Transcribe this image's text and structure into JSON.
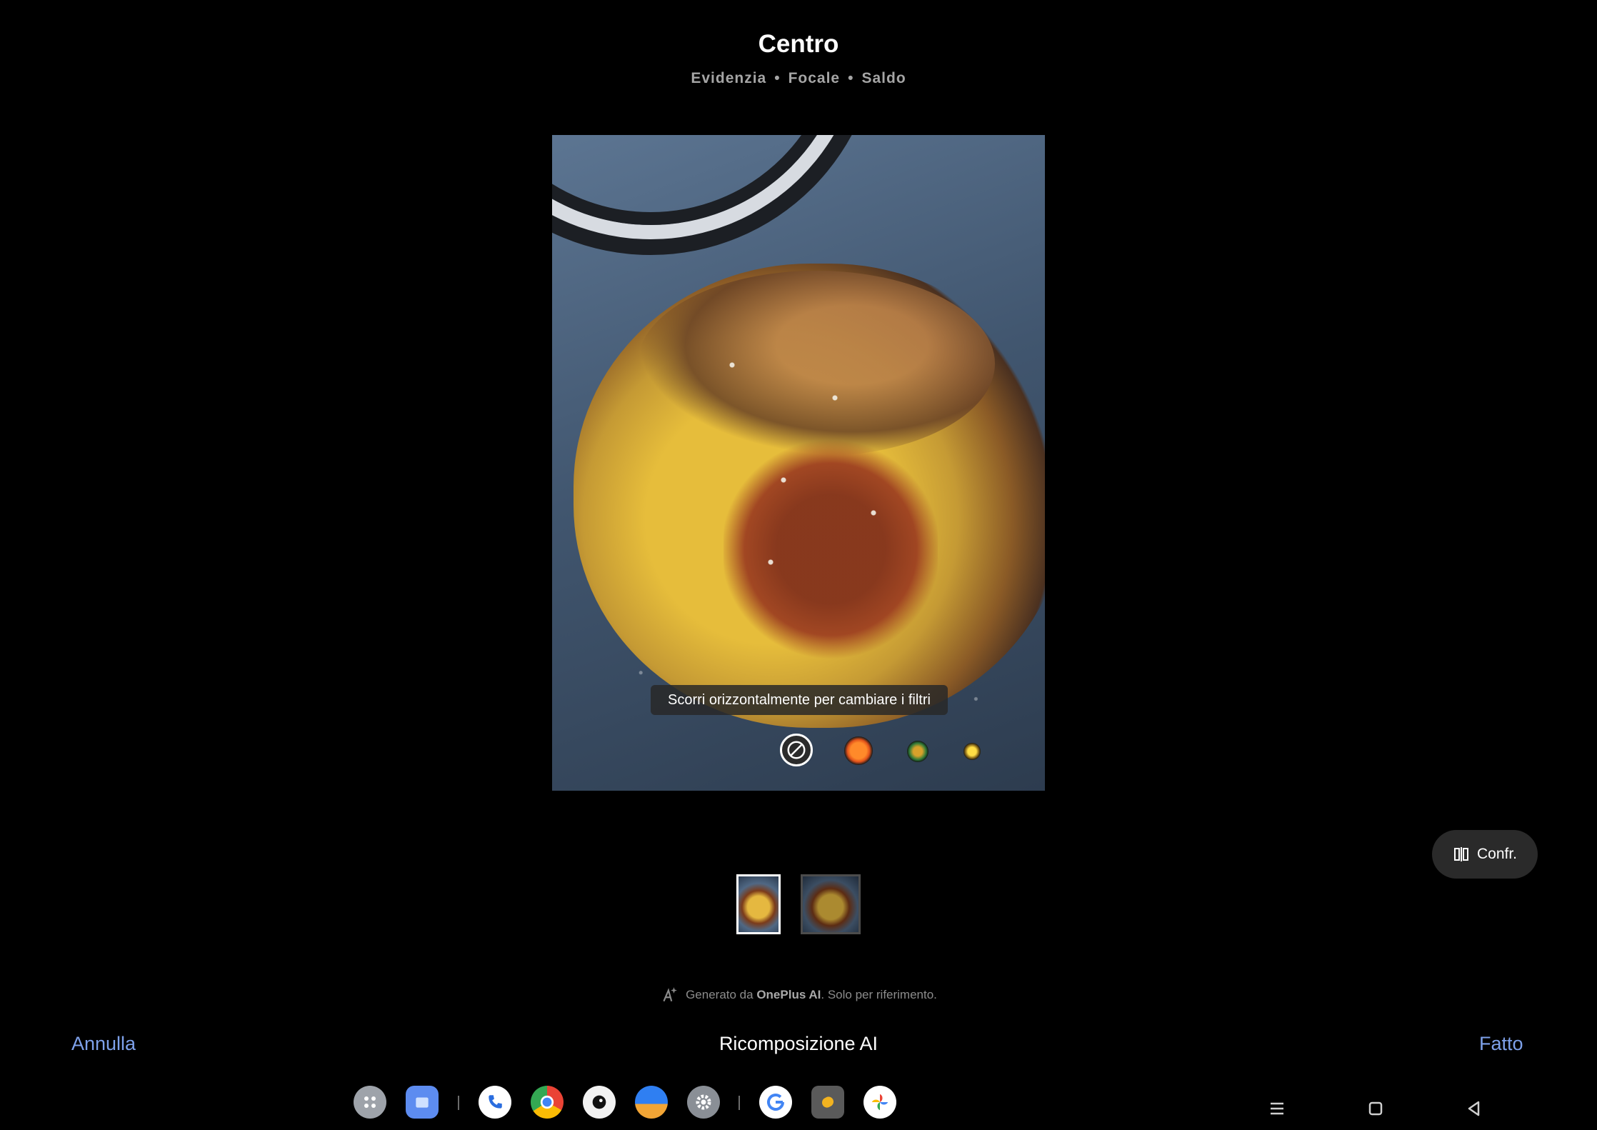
{
  "header": {
    "title": "Centro",
    "options": [
      "Evidenzia",
      "Focale",
      "Saldo"
    ]
  },
  "photo": {
    "hint": "Scorri orizzontalmente per cambiare i filtri"
  },
  "compare_button": {
    "label": "Confr."
  },
  "ai_note": {
    "prefix": "Generato da ",
    "brand": "OnePlus AI",
    "suffix": ". Solo per riferimento."
  },
  "bottom_bar": {
    "cancel": "Annulla",
    "title": "Ricomposizione AI",
    "done": "Fatto"
  },
  "taskbar": {
    "apps": [
      "app-drawer-icon",
      "files-icon",
      "phone-icon",
      "chrome-icon",
      "camera-icon",
      "weather-icon",
      "settings-icon",
      "google-icon",
      "clipboard-icon",
      "photos-icon"
    ]
  },
  "colors": {
    "accent": "#7ea1ea",
    "background": "#000000",
    "muted_text": "#a5a5a5"
  }
}
